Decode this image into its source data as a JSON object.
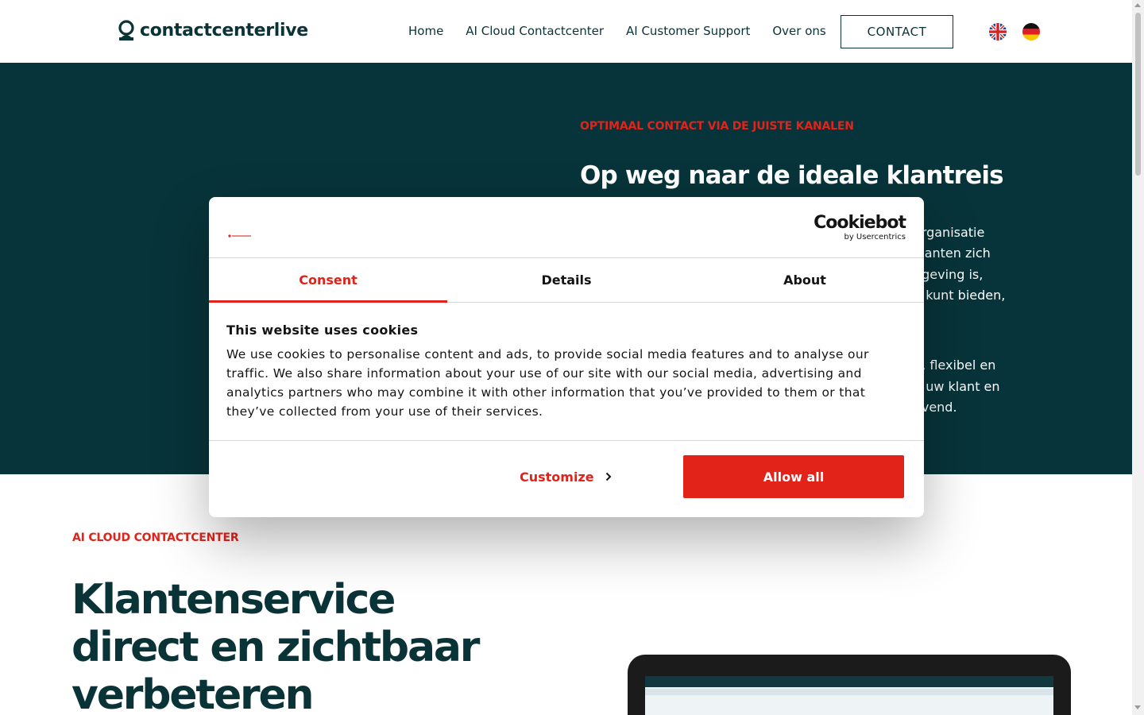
{
  "header": {
    "logo_text": "contactcenterlive",
    "nav": [
      "Home",
      "AI Cloud Contactcenter",
      "AI Customer Support",
      "Over ons"
    ],
    "contact_label": "CONTACT",
    "languages": [
      "English",
      "Deutsch"
    ]
  },
  "hero": {
    "eyebrow": "OPTIMAAL CONTACT VIA DE JUISTE KANALEN",
    "title": "Op weg naar de ideale klantreis",
    "visible_lines": [
      "organisatie",
      "klanten zich",
      "ngeving is,",
      "g kunt bieden,",
      "",
      "g, flexibel en",
      "n uw klant en",
      "evend."
    ]
  },
  "section": {
    "eyebrow": "AI CLOUD CONTACTCENTER",
    "title_lines": [
      "Klantenservice",
      "direct en zichtbaar",
      "verbeteren"
    ]
  },
  "cookie": {
    "brand": "Cookiebot",
    "brand_sub": "by Usercentrics",
    "tabs": [
      "Consent",
      "Details",
      "About"
    ],
    "title": "This website uses cookies",
    "text": "We use cookies to personalise content and ads, to provide social media features and to analyse our traffic. We also share information about your use of our site with our social media, advertising and analytics partners who may combine it with other information that you’ve provided to them or that they’ve collected from your use of their services.",
    "customize_label": "Customize",
    "allow_label": "Allow all"
  },
  "colors": {
    "brand_dark": "#07343a",
    "accent_red": "#e2231a",
    "text_dark": "#0a3338"
  }
}
